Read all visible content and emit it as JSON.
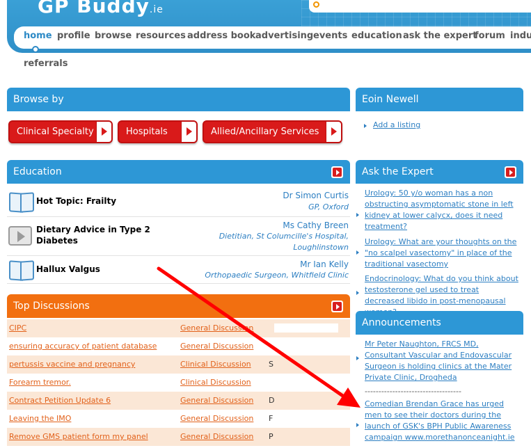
{
  "header": {
    "logo": "GP Buddy",
    "logo_suffix": ".ie",
    "nav": [
      "home",
      "profile",
      "browse",
      "resources",
      "address book",
      "advertising",
      "events",
      "education",
      "ask the expert",
      "forum",
      "indus"
    ],
    "nav_second_row": "referrals"
  },
  "browse": {
    "title": "Browse by",
    "buttons": [
      "Clinical Specialty",
      "Hospitals",
      "Allied/Ancillary Services"
    ]
  },
  "user": {
    "name": "Eoin Newell",
    "link": "Add a listing"
  },
  "education": {
    "title": "Education",
    "items": [
      {
        "title": "Hot Topic: Frailty",
        "author": "Dr Simon Curtis",
        "role": "GP, Oxford"
      },
      {
        "title": "Dietary Advice in Type 2 Diabetes",
        "author": "Ms Cathy Breen",
        "role": "Dietitian, St Columcille's Hospital, Loughlinstown"
      },
      {
        "title": "Hallux Valgus",
        "author": "Mr Ian Kelly",
        "role": "Orthopaedic Surgeon, Whitfield Clinic"
      }
    ]
  },
  "ask_expert": {
    "title": "Ask the Expert",
    "items": [
      "Urology: 50 y/o woman has a non obstructing asymptomatic stone in left kidney at lower calycx, does it need treatment?",
      "Urology: What are your thoughts on the \"no scalpel vasectomy\" in place of the traditional vasectomy",
      "Endocrinology: What do you think about testosterone gel used to treat decreased libido in post-menopausal women?"
    ]
  },
  "discussions": {
    "title": "Top Discussions",
    "rows": [
      {
        "topic": "CIPC",
        "forum": "General Discussion",
        "user": ""
      },
      {
        "topic": "ensuring accuracy of patient database",
        "forum": "General Discussion",
        "user": ""
      },
      {
        "topic": "pertussis vaccine and pregnancy",
        "forum": "Clinical Discussion",
        "user": "S"
      },
      {
        "topic": "Forearm  tremor.",
        "forum": "Clinical Discussion",
        "user": ""
      },
      {
        "topic": "Contract Petition Update 6",
        "forum": "General Discussion",
        "user": "D"
      },
      {
        "topic": "Leaving the IMO",
        "forum": "General Discussion",
        "user": "F"
      },
      {
        "topic": "Remove GMS patient form my panel",
        "forum": "General Discussion",
        "user": "P"
      }
    ]
  },
  "announcements": {
    "title": "Announcements",
    "items": [
      "Mr Peter Naughton, FRCS MD, Consultant Vascular and Endovascular Surgeon is holding clinics at the Mater Private Clinic, Drogheda",
      "Comedian Brendan Grace has urged men to see their doctors during the launch of GSK's BPH Public Awareness campaign www.morethanonceanight.ie"
    ],
    "separator": "-----------------------------------"
  },
  "colors": {
    "accent": "#2d97d6",
    "orange": "#f26f10",
    "red": "#d91a1a",
    "annotation": "#ff0000"
  }
}
